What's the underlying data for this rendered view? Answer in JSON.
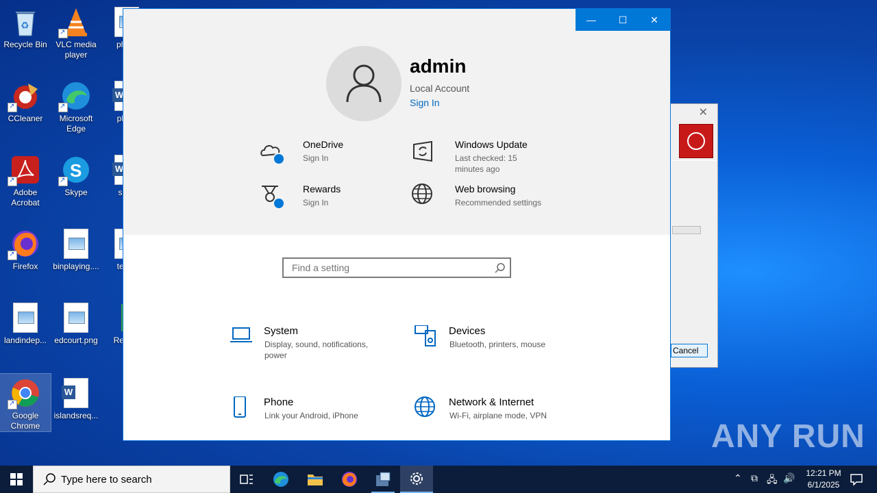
{
  "desktop": {
    "icons": [
      {
        "label": "Recycle Bin"
      },
      {
        "label": "VLC media player"
      },
      {
        "label": "photo"
      },
      {
        "label": "CCleaner"
      },
      {
        "label": "Microsoft Edge"
      },
      {
        "label": "place"
      },
      {
        "label": "Adobe Acrobat"
      },
      {
        "label": "Skype"
      },
      {
        "label": "such"
      },
      {
        "label": "Firefox"
      },
      {
        "label": "binplaying...."
      },
      {
        "label": "techc"
      },
      {
        "label": "landindep..."
      },
      {
        "label": "edcourt.png"
      },
      {
        "label": "Re Lau"
      },
      {
        "label": "Google Chrome"
      },
      {
        "label": "islandsreq..."
      }
    ]
  },
  "background_dialog": {
    "cancel_label": "Cancel"
  },
  "settings": {
    "account": {
      "name": "admin",
      "type": "Local Account",
      "sign_in": "Sign In"
    },
    "tiles": [
      {
        "title": "OneDrive",
        "subtitle": "Sign In",
        "icon": "cloud-icon"
      },
      {
        "title": "Windows Update",
        "subtitle": "Last checked: 15 minutes ago",
        "icon": "update-icon"
      },
      {
        "title": "Rewards",
        "subtitle": "Sign In",
        "icon": "medal-icon"
      },
      {
        "title": "Web browsing",
        "subtitle": "Recommended settings",
        "icon": "globe-icon"
      }
    ],
    "search": {
      "placeholder": "Find a setting"
    },
    "categories": [
      {
        "title": "System",
        "subtitle": "Display, sound, notifications, power",
        "icon": "laptop-icon"
      },
      {
        "title": "Devices",
        "subtitle": "Bluetooth, printers, mouse",
        "icon": "keyboard-speaker-icon"
      },
      {
        "title": "Phone",
        "subtitle": "Link your Android, iPhone",
        "icon": "phone-icon"
      },
      {
        "title": "Network & Internet",
        "subtitle": "Wi-Fi, airplane mode, VPN",
        "icon": "globe-icon"
      }
    ]
  },
  "taskbar": {
    "search_placeholder": "Type here to search",
    "time": "12:21 PM",
    "date": "6/1/2025"
  },
  "watermark": "ANY RUN",
  "colors": {
    "accent": "#0078d7",
    "link": "#0067c0",
    "taskbar": "#0b1d3a"
  }
}
